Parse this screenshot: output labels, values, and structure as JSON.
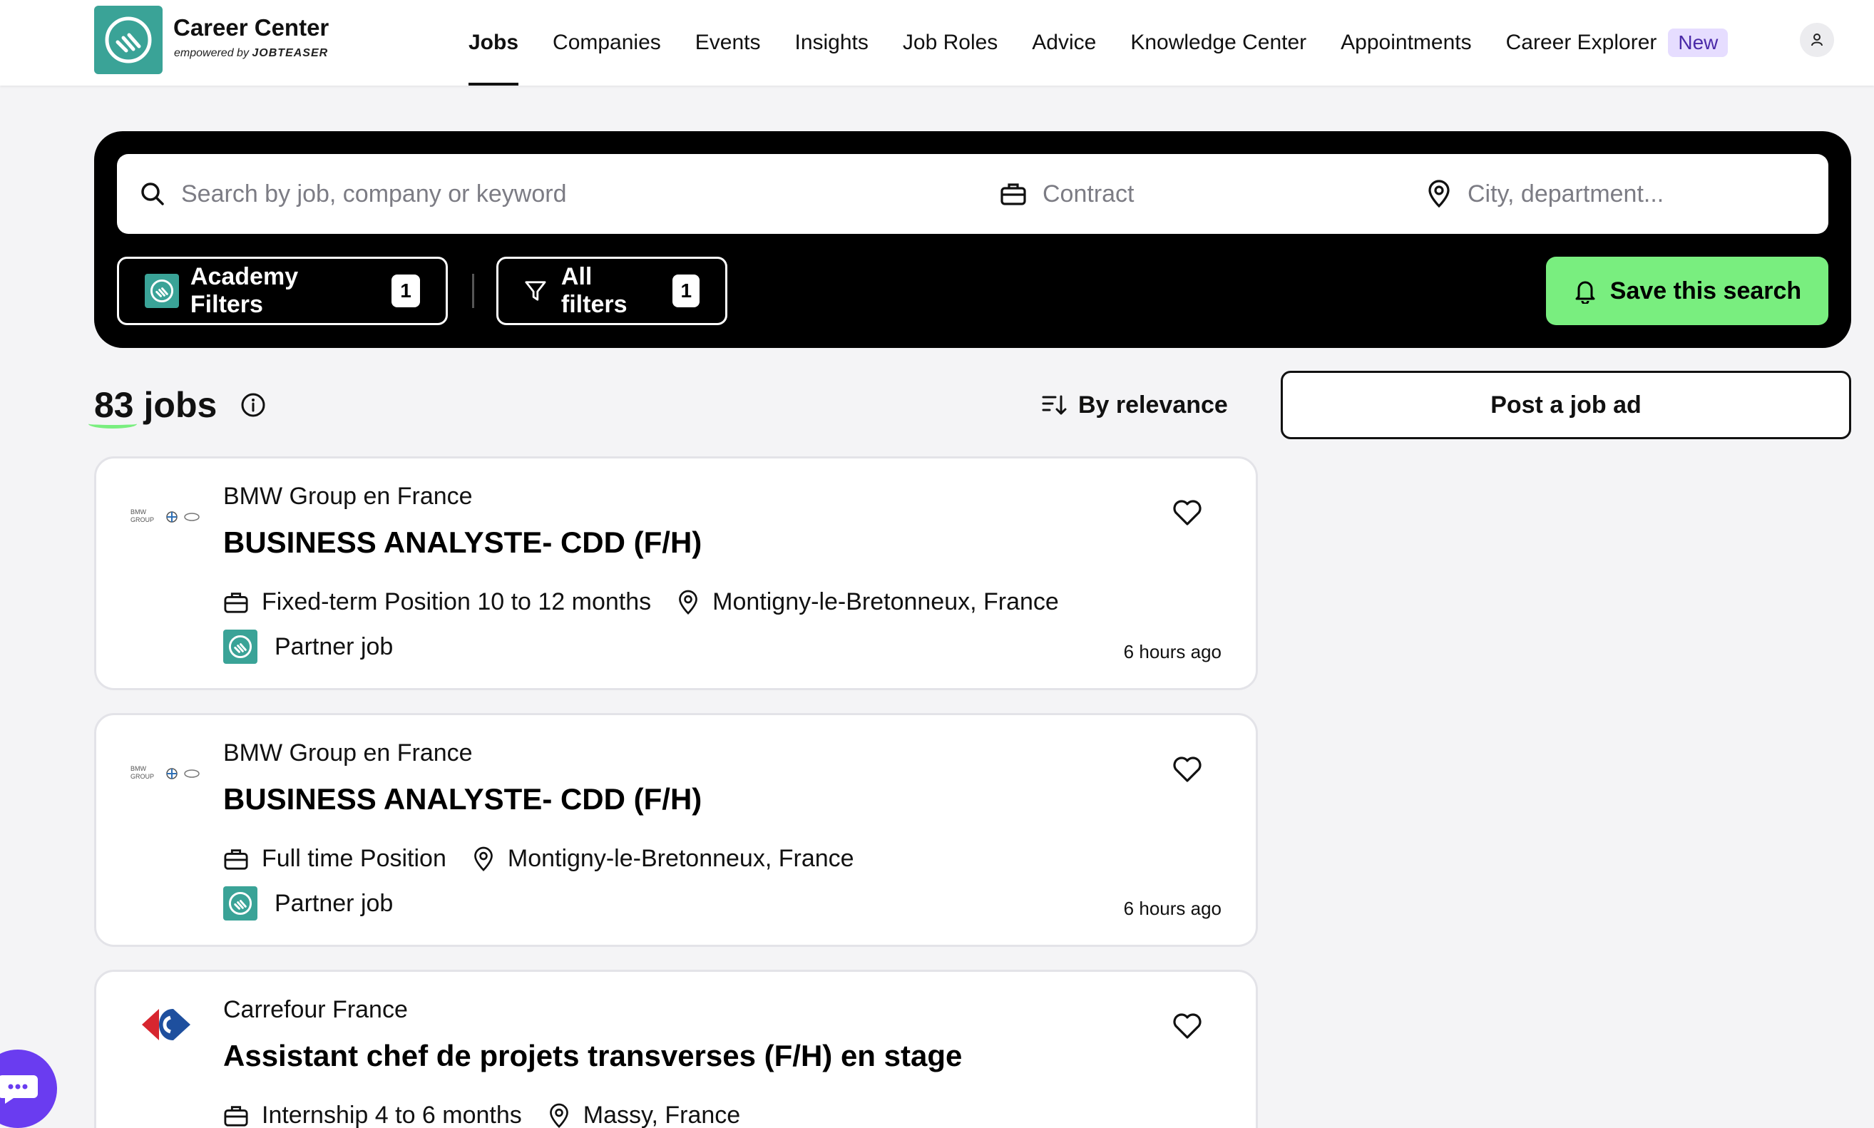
{
  "brand": {
    "title": "Career Center",
    "subtitle_prefix": "empowered by",
    "subtitle_brand": "JOBTEASER",
    "logo_color": "#3aa397"
  },
  "nav": {
    "items": [
      {
        "label": "Jobs",
        "active": true
      },
      {
        "label": "Companies"
      },
      {
        "label": "Events"
      },
      {
        "label": "Insights"
      },
      {
        "label": "Job Roles"
      },
      {
        "label": "Advice"
      },
      {
        "label": "Knowledge Center"
      },
      {
        "label": "Appointments"
      },
      {
        "label": "Career Explorer",
        "badge": "New"
      }
    ]
  },
  "search": {
    "keyword_placeholder": "Search by job, company or keyword",
    "contract_placeholder": "Contract",
    "location_placeholder": "City, department..."
  },
  "filters": {
    "academy_label": "Academy Filters",
    "academy_count": "1",
    "all_label": "All filters",
    "all_count": "1",
    "save_label": "Save this search",
    "save_color": "#79ee7f"
  },
  "results": {
    "count": "83",
    "count_suffix": "jobs",
    "sort_label": "By relevance",
    "post_label": "Post a job ad"
  },
  "jobs": [
    {
      "company": "BMW Group en France",
      "title": "BUSINESS ANALYSTE- CDD (F/H)",
      "contract": "Fixed-term Position 10 to 12 months",
      "location": "Montigny-le-Bretonneux, France",
      "tag": "Partner job",
      "posted": "6 hours ago"
    },
    {
      "company": "BMW Group en France",
      "title": "BUSINESS ANALYSTE- CDD (F/H)",
      "contract": "Full time Position",
      "location": "Montigny-le-Bretonneux, France",
      "tag": "Partner job",
      "posted": "6 hours ago"
    },
    {
      "company": "Carrefour France",
      "title": "Assistant chef de projets transverses (F/H) en stage",
      "contract": "Internship 4 to 6 months",
      "location": "Massy, France"
    }
  ]
}
